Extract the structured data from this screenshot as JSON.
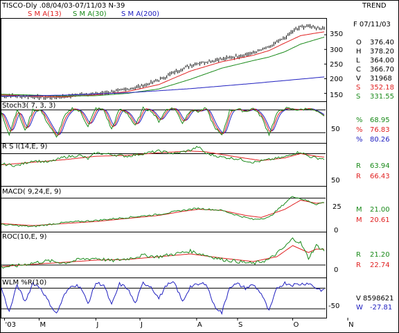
{
  "header": {
    "title": "TISCO-Dly .08/04/03-07/11/03  N-39",
    "trend": "TREND",
    "sma": [
      {
        "label": "S M A(13)",
        "color": "#e02020"
      },
      {
        "label": "S M A(30)",
        "color": "#1a8a1a"
      },
      {
        "label": "S M A(200)",
        "color": "#2020c0"
      }
    ]
  },
  "colors": {
    "price": "#000000",
    "red": "#e02020",
    "green": "#1a8a1a",
    "blue": "#2020c0",
    "frame": "#000000",
    "grid": "#000000"
  },
  "chart_data": [
    {
      "type": "candlestick",
      "name": "price",
      "title": "TISCO-Dly .08/04/03-07/11/03  N-39",
      "yticks": [
        "350",
        "300",
        "250",
        "200",
        "150"
      ],
      "ylim": [
        130,
        400
      ],
      "readout": [
        {
          "label": "F 07/11/03",
          "value": "",
          "color": "#000000"
        },
        {
          "label": "O",
          "value": "376.40",
          "color": "#000000"
        },
        {
          "label": "H",
          "value": "378.20",
          "color": "#000000"
        },
        {
          "label": "L",
          "value": "364.00",
          "color": "#000000"
        },
        {
          "label": "C",
          "value": "366.70",
          "color": "#000000"
        },
        {
          "label": "V",
          "value": "31968",
          "color": "#000000"
        },
        {
          "label": "S",
          "value": "352.18",
          "color": "#e02020"
        },
        {
          "label": "S",
          "value": "331.55",
          "color": "#1a8a1a"
        }
      ],
      "close_knots": [
        [
          0,
          143
        ],
        [
          10,
          140
        ],
        [
          20,
          138
        ],
        [
          30,
          136
        ],
        [
          40,
          139
        ],
        [
          50,
          146
        ],
        [
          60,
          148
        ],
        [
          70,
          155
        ],
        [
          80,
          165
        ],
        [
          90,
          176
        ],
        [
          100,
          196
        ],
        [
          110,
          222
        ],
        [
          120,
          246
        ],
        [
          130,
          258
        ],
        [
          140,
          267
        ],
        [
          150,
          276
        ],
        [
          160,
          288
        ],
        [
          170,
          308
        ],
        [
          180,
          340
        ],
        [
          185,
          362
        ],
        [
          190,
          376
        ],
        [
          195,
          380
        ],
        [
          200,
          374
        ],
        [
          205,
          372
        ]
      ],
      "sma13_knots": [
        [
          0,
          145
        ],
        [
          20,
          140
        ],
        [
          40,
          138
        ],
        [
          60,
          145
        ],
        [
          80,
          156
        ],
        [
          100,
          180
        ],
        [
          120,
          226
        ],
        [
          140,
          258
        ],
        [
          160,
          280
        ],
        [
          170,
          296
        ],
        [
          180,
          322
        ],
        [
          190,
          347
        ],
        [
          200,
          356
        ],
        [
          205,
          360
        ]
      ],
      "sma30_knots": [
        [
          0,
          147
        ],
        [
          20,
          144
        ],
        [
          40,
          141
        ],
        [
          60,
          142
        ],
        [
          80,
          150
        ],
        [
          100,
          165
        ],
        [
          120,
          198
        ],
        [
          140,
          236
        ],
        [
          160,
          262
        ],
        [
          170,
          274
        ],
        [
          180,
          292
        ],
        [
          190,
          318
        ],
        [
          200,
          334
        ],
        [
          205,
          342
        ]
      ],
      "sma200_knots": [
        [
          0,
          140
        ],
        [
          40,
          144
        ],
        [
          80,
          152
        ],
        [
          120,
          166
        ],
        [
          160,
          184
        ],
        [
          205,
          206
        ]
      ]
    },
    {
      "type": "line",
      "name": "Stoch3(7, 3, 3)",
      "title": "Stoch3( 7, 3, 3)",
      "yticks": [
        "50"
      ],
      "ylim": [
        -5,
        110
      ],
      "levels": [
        90,
        20
      ],
      "readout": [
        {
          "label": "%",
          "value": "68.95",
          "color": "#1a8a1a"
        },
        {
          "label": "%",
          "value": "76.83",
          "color": "#e02020"
        },
        {
          "label": "%",
          "value": "80.26",
          "color": "#2020c0"
        }
      ],
      "k_knots": [
        [
          0,
          80
        ],
        [
          5,
          15
        ],
        [
          10,
          92
        ],
        [
          15,
          25
        ],
        [
          20,
          90
        ],
        [
          25,
          88
        ],
        [
          30,
          45
        ],
        [
          35,
          5
        ],
        [
          40,
          70
        ],
        [
          45,
          95
        ],
        [
          50,
          85
        ],
        [
          55,
          40
        ],
        [
          60,
          95
        ],
        [
          65,
          90
        ],
        [
          70,
          30
        ],
        [
          75,
          92
        ],
        [
          80,
          80
        ],
        [
          85,
          40
        ],
        [
          90,
          95
        ],
        [
          95,
          88
        ],
        [
          100,
          55
        ],
        [
          105,
          92
        ],
        [
          110,
          95
        ],
        [
          115,
          50
        ],
        [
          120,
          90
        ],
        [
          125,
          85
        ],
        [
          130,
          95
        ],
        [
          135,
          40
        ],
        [
          140,
          10
        ],
        [
          145,
          88
        ],
        [
          150,
          92
        ],
        [
          155,
          85
        ],
        [
          160,
          95
        ],
        [
          165,
          70
        ],
        [
          170,
          15
        ],
        [
          175,
          80
        ],
        [
          180,
          95
        ],
        [
          185,
          92
        ],
        [
          190,
          90
        ],
        [
          195,
          95
        ],
        [
          200,
          85
        ],
        [
          205,
          69
        ]
      ]
    },
    {
      "type": "line",
      "name": "RSI(14,E,9)",
      "title": "R S I(14,E, 9)",
      "yticks": [
        "50"
      ],
      "ylim": [
        35,
        80
      ],
      "levels": [
        70
      ],
      "readout": [
        {
          "label": "R",
          "value": "63.94",
          "color": "#1a8a1a"
        },
        {
          "label": "R",
          "value": "66.43",
          "color": "#e02020"
        }
      ],
      "rsi_knots": [
        [
          0,
          58
        ],
        [
          10,
          56
        ],
        [
          20,
          62
        ],
        [
          30,
          60
        ],
        [
          40,
          66
        ],
        [
          50,
          68
        ],
        [
          55,
          64
        ],
        [
          60,
          71
        ],
        [
          70,
          69
        ],
        [
          80,
          67
        ],
        [
          90,
          70
        ],
        [
          100,
          73
        ],
        [
          110,
          70
        ],
        [
          120,
          74
        ],
        [
          125,
          78
        ],
        [
          130,
          70
        ],
        [
          140,
          66
        ],
        [
          150,
          64
        ],
        [
          160,
          60
        ],
        [
          170,
          63
        ],
        [
          180,
          66
        ],
        [
          185,
          70
        ],
        [
          190,
          72
        ],
        [
          195,
          67
        ],
        [
          200,
          65
        ],
        [
          205,
          64
        ]
      ],
      "sig_knots": [
        [
          0,
          57
        ],
        [
          20,
          60
        ],
        [
          40,
          63
        ],
        [
          60,
          67
        ],
        [
          80,
          68
        ],
        [
          100,
          71
        ],
        [
          120,
          73
        ],
        [
          130,
          72
        ],
        [
          150,
          66
        ],
        [
          165,
          62
        ],
        [
          180,
          65
        ],
        [
          190,
          70
        ],
        [
          200,
          67
        ],
        [
          205,
          66
        ]
      ]
    },
    {
      "type": "line",
      "name": "MACD(9,24,E,9)",
      "title": "MACD( 9,24,E, 9)",
      "yticks": [
        "25",
        "0"
      ],
      "ylim": [
        -6,
        35
      ],
      "levels": [
        25
      ],
      "readout": [
        {
          "label": "M",
          "value": "21.00",
          "color": "#1a8a1a"
        },
        {
          "label": "M",
          "value": "20.61",
          "color": "#e02020"
        }
      ],
      "macd_knots": [
        [
          0,
          -1
        ],
        [
          20,
          -3
        ],
        [
          40,
          1
        ],
        [
          60,
          3
        ],
        [
          80,
          6
        ],
        [
          100,
          9
        ],
        [
          115,
          13
        ],
        [
          125,
          15
        ],
        [
          140,
          13
        ],
        [
          150,
          8
        ],
        [
          160,
          4
        ],
        [
          170,
          6
        ],
        [
          180,
          20
        ],
        [
          185,
          27
        ],
        [
          195,
          22
        ],
        [
          200,
          19
        ],
        [
          205,
          21
        ]
      ],
      "sig_knots": [
        [
          0,
          0
        ],
        [
          20,
          -2
        ],
        [
          40,
          0
        ],
        [
          60,
          2
        ],
        [
          80,
          5
        ],
        [
          100,
          8
        ],
        [
          115,
          12
        ],
        [
          125,
          14
        ],
        [
          140,
          13
        ],
        [
          155,
          8
        ],
        [
          165,
          6
        ],
        [
          180,
          14
        ],
        [
          190,
          23
        ],
        [
          200,
          20
        ],
        [
          205,
          20.6
        ]
      ]
    },
    {
      "type": "line",
      "name": "ROC(10,E,9)",
      "title": "ROC(10,E, 9)",
      "yticks": [
        "0"
      ],
      "ylim": [
        -15,
        45
      ],
      "levels": [
        0
      ],
      "readout": [
        {
          "label": "R",
          "value": "21.20",
          "color": "#1a8a1a"
        },
        {
          "label": "R",
          "value": "22.74",
          "color": "#e02020"
        }
      ],
      "roc_knots": [
        [
          0,
          -3
        ],
        [
          10,
          -1
        ],
        [
          20,
          3
        ],
        [
          30,
          6
        ],
        [
          40,
          3
        ],
        [
          50,
          8
        ],
        [
          60,
          10
        ],
        [
          70,
          6
        ],
        [
          80,
          9
        ],
        [
          90,
          14
        ],
        [
          100,
          12
        ],
        [
          110,
          16
        ],
        [
          120,
          20
        ],
        [
          130,
          14
        ],
        [
          140,
          8
        ],
        [
          150,
          5
        ],
        [
          160,
          2
        ],
        [
          170,
          8
        ],
        [
          180,
          26
        ],
        [
          185,
          38
        ],
        [
          190,
          32
        ],
        [
          195,
          10
        ],
        [
          200,
          28
        ],
        [
          205,
          21
        ]
      ],
      "sig_knots": [
        [
          0,
          -2
        ],
        [
          20,
          1
        ],
        [
          40,
          4
        ],
        [
          60,
          7
        ],
        [
          80,
          8
        ],
        [
          100,
          12
        ],
        [
          120,
          16
        ],
        [
          140,
          10
        ],
        [
          160,
          5
        ],
        [
          175,
          12
        ],
        [
          185,
          28
        ],
        [
          195,
          18
        ],
        [
          200,
          23
        ],
        [
          205,
          22.7
        ]
      ]
    },
    {
      "type": "line",
      "name": "WLM %R(10)",
      "title": "WLM %R(10)",
      "yticks": [
        "-50"
      ],
      "ylim": [
        -100,
        5
      ],
      "levels": [
        -20,
        -80
      ],
      "readout": [
        {
          "label": "V",
          "value": "8598621",
          "color": "#000000"
        },
        {
          "label": "W",
          "value": "-27.81",
          "color": "#2020c0"
        }
      ],
      "wr_knots": [
        [
          0,
          -20
        ],
        [
          5,
          -90
        ],
        [
          10,
          -10
        ],
        [
          15,
          -60
        ],
        [
          20,
          -5
        ],
        [
          25,
          -20
        ],
        [
          30,
          -60
        ],
        [
          35,
          -95
        ],
        [
          40,
          -40
        ],
        [
          45,
          -10
        ],
        [
          50,
          -15
        ],
        [
          55,
          -65
        ],
        [
          60,
          -5
        ],
        [
          65,
          -10
        ],
        [
          70,
          -70
        ],
        [
          75,
          -8
        ],
        [
          80,
          -20
        ],
        [
          85,
          -65
        ],
        [
          90,
          -5
        ],
        [
          95,
          -15
        ],
        [
          100,
          -50
        ],
        [
          105,
          -10
        ],
        [
          110,
          -5
        ],
        [
          115,
          -60
        ],
        [
          120,
          -15
        ],
        [
          125,
          -10
        ],
        [
          130,
          -5
        ],
        [
          135,
          -70
        ],
        [
          140,
          -92
        ],
        [
          145,
          -15
        ],
        [
          150,
          -8
        ],
        [
          155,
          -20
        ],
        [
          160,
          -10
        ],
        [
          165,
          -35
        ],
        [
          170,
          -88
        ],
        [
          175,
          -20
        ],
        [
          180,
          -5
        ],
        [
          185,
          -10
        ],
        [
          190,
          -8
        ],
        [
          195,
          -5
        ],
        [
          200,
          -20
        ],
        [
          205,
          -28
        ]
      ]
    }
  ],
  "xaxis": {
    "labels": [
      {
        "text": "'03",
        "pos": 2
      },
      {
        "text": "M",
        "pos": 24
      },
      {
        "text": "J",
        "pos": 60
      },
      {
        "text": "J",
        "pos": 88
      },
      {
        "text": "A",
        "pos": 124
      },
      {
        "text": "S",
        "pos": 150
      },
      {
        "text": "O",
        "pos": 185
      },
      {
        "text": "N",
        "pos": 220
      }
    ]
  }
}
